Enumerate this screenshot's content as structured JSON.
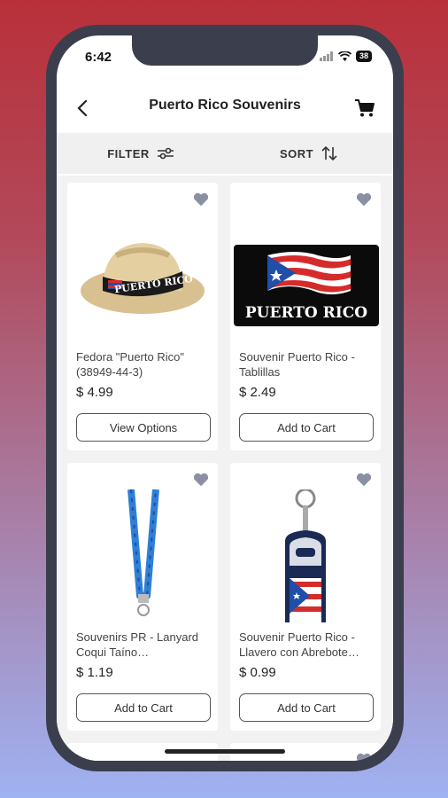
{
  "status_bar": {
    "time": "6:42",
    "battery": "38"
  },
  "header": {
    "title": "Puerto Rico Souvenirs"
  },
  "toolbar": {
    "filter_label": "FILTER",
    "sort_label": "SORT"
  },
  "products": [
    {
      "name": "Fedora \"Puerto Rico\" (38949-44-3)",
      "price": "$ 4.99",
      "button": "View Options",
      "image": "straw-fedora-hat",
      "hat_text": "PUERTO RICO"
    },
    {
      "name": "Souvenir Puerto Rico - Tablillas",
      "price": "$ 2.49",
      "button": "Add to Cart",
      "image": "license-plate-flag",
      "plate_text": "PUERTO RICO"
    },
    {
      "name": "Souvenirs PR - Lanyard Coqui Taíno…",
      "price": "$ 1.19",
      "button": "Add to Cart",
      "image": "blue-lanyard"
    },
    {
      "name": "Souvenir Puerto Rico - Llavero con Abrebote…",
      "price": "$ 0.99",
      "button": "Add to Cart",
      "image": "bottle-opener-keychain"
    }
  ],
  "colors": {
    "flag_red": "#d62b2b",
    "flag_blue": "#1f4fa8",
    "heart": "#8a8fa3"
  }
}
